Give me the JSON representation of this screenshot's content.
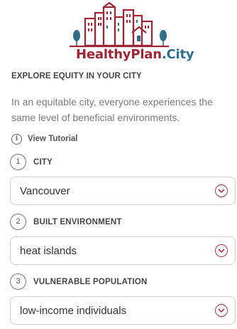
{
  "logo": {
    "text_a": "HealthyPlan",
    "text_b": ".City",
    "icon": "city-skyline-logo-icon"
  },
  "section_title": "EXPLORE EQUITY IN YOUR CITY",
  "description": "In an equitable city, everyone experiences the same level of beneficial environments.",
  "tutorial": {
    "label": "View Tutorial",
    "icon": "info-icon"
  },
  "steps": [
    {
      "number": "1",
      "label": "CITY",
      "value": "Vancouver"
    },
    {
      "number": "2",
      "label": "BUILT ENVIRONMENT",
      "value": "heat islands"
    },
    {
      "number": "3",
      "label": "VULNERABLE POPULATION",
      "value": "low-income individuals"
    }
  ],
  "colors": {
    "brand_red": "#9c2536",
    "brand_blue": "#2f6e8b",
    "accent": "#a33a4c"
  }
}
